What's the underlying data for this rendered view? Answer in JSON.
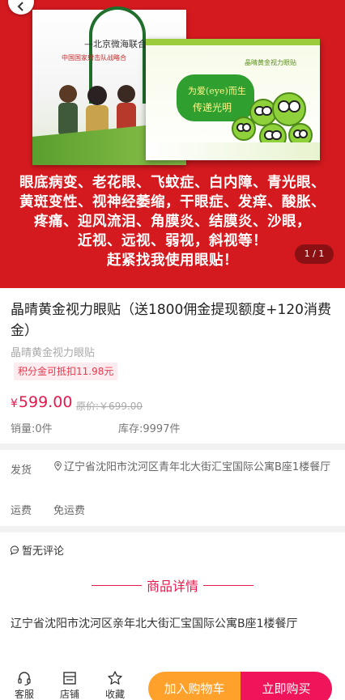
{
  "banner": {
    "box1_title": "—北京微海联合",
    "box1_sub": "中国国家射击队战略合",
    "box2_brand": "晶晴黄金视力眼贴",
    "box2_slogan_1": "为爱(eye)而生",
    "box2_slogan_2": "传递光明",
    "lines": [
      "眼底病变、老花眼、飞蚊症、白内障、青光眼、",
      "黄斑变性、视神经萎缩，干眼症、发痒、酸胀、",
      "疼痛、迎风流泪、角膜炎、结膜炎、沙眼，",
      "近视、远视、弱视，斜视等！",
      "赶紧找我使用眼贴！"
    ],
    "page_indicator": "1 / 1"
  },
  "product": {
    "title": "晶晴黄金视力眼贴（送1800佣金提现额度+120消费金）",
    "subtitle": "晶晴黄金视力眼贴",
    "points_tag": "积分金可抵扣11.98元",
    "currency": "¥",
    "price": "599.00",
    "original_price": "原价:￥699.00",
    "sales": "销量:0件",
    "stock": "库存:9997件"
  },
  "shipping": {
    "from_label": "发货",
    "address": "辽宁省沈阳市沈河区青年北大街汇宝国际公寓B座1楼餐厅",
    "fee_label": "运费",
    "fee_value": "免运费"
  },
  "comments": {
    "text": "暂无评论"
  },
  "detail": {
    "title": "商品详情",
    "body": "辽宁省沈阳市沈河区亲年北大街汇宝国际公寓B座1楼餐厅"
  },
  "bottom_bar": {
    "service_label": "客服",
    "store_label": "店铺",
    "favorite_label": "收藏",
    "add_to_cart_label": "加入购物车",
    "buy_now_label": "立即购买"
  },
  "colors": {
    "accent": "#e6194d",
    "cart_button": "#ffa12a",
    "buy_button": "#f0145a",
    "banner_bg": "#d51a1f"
  }
}
